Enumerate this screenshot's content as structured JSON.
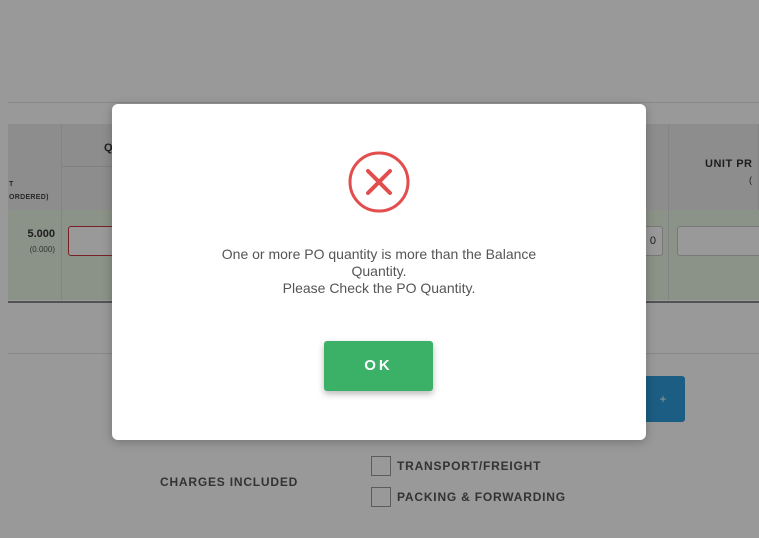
{
  "table": {
    "header_partial_left": "T",
    "header_ordered": "ORDERED)",
    "header_qty_partial": "Q",
    "header_unit_price_partial": "UNIT PR",
    "header_unit_price_sub_partial": "(",
    "row_value": "5.000",
    "row_value_sub": "(0.000)",
    "row_partial_value": "0"
  },
  "add_button": {
    "label": "+"
  },
  "charges": {
    "label": "CHARGES INCLUDED",
    "options": [
      {
        "label": "TRANSPORT/FREIGHT",
        "checked": false
      },
      {
        "label": "PACKING & FORWARDING",
        "checked": false
      }
    ]
  },
  "modal": {
    "icon": "error-x-circle-icon",
    "message_lines": [
      "One or more PO quantity is more than the Balance",
      "Quantity.",
      "Please Check the PO Quantity."
    ],
    "ok_label": "OK"
  },
  "colors": {
    "error_red": "#e24d4d",
    "ok_green": "#3bb067",
    "accent_blue": "#2d9cdb",
    "row_green": "#e8f3e1"
  }
}
